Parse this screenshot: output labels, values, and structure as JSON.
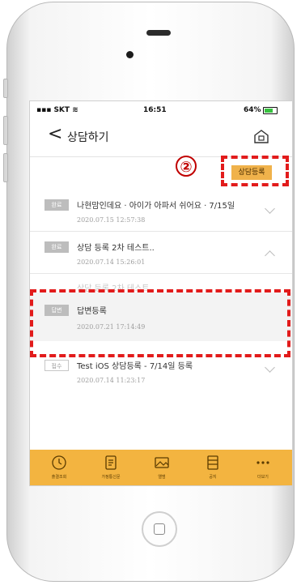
{
  "status_bar": {
    "carrier": "SKT",
    "time": "16:51",
    "battery": "64%"
  },
  "header": {
    "title": "상담하기",
    "back_glyph": "<",
    "home_icon": "home-icon"
  },
  "annotation": {
    "marker": "②"
  },
  "register_button": {
    "label": "상담등록"
  },
  "consultations": [
    {
      "status": "완료",
      "title": "나현맘인데요 · 아이가 아파서 쉬어요 · 7/15일",
      "date": "2020.07.15 12:57:38",
      "expanded": false
    },
    {
      "status": "완료",
      "title": "상담 등록 2차 테스트..",
      "date": "2020.07.14 15:26:01",
      "expanded": true
    }
  ],
  "expanded_detail": {
    "ghost_text": "상담 등록 2차 테스트"
  },
  "reply": {
    "status": "답변",
    "title": "답변등록",
    "date": "2020.07.21 17:14:49"
  },
  "consultation_last": {
    "status": "접수",
    "title": "Test iOS 상담등록 - 7/14일 등록",
    "date": "2020.07.14 11:23:17",
    "expanded": false
  },
  "tabbar": {
    "color": "#f3b440",
    "items": [
      {
        "label": "출결조회",
        "icon": "clock-icon"
      },
      {
        "label": "가정통신문",
        "icon": "document-icon"
      },
      {
        "label": "앨범",
        "icon": "album-icon"
      },
      {
        "label": "공지",
        "icon": "notice-icon"
      },
      {
        "label": "더보기",
        "icon": "more-icon"
      }
    ]
  },
  "colors": {
    "accent": "#f0b24b",
    "highlight": "#e21b1b",
    "badge_gray": "#bdbdbd"
  }
}
